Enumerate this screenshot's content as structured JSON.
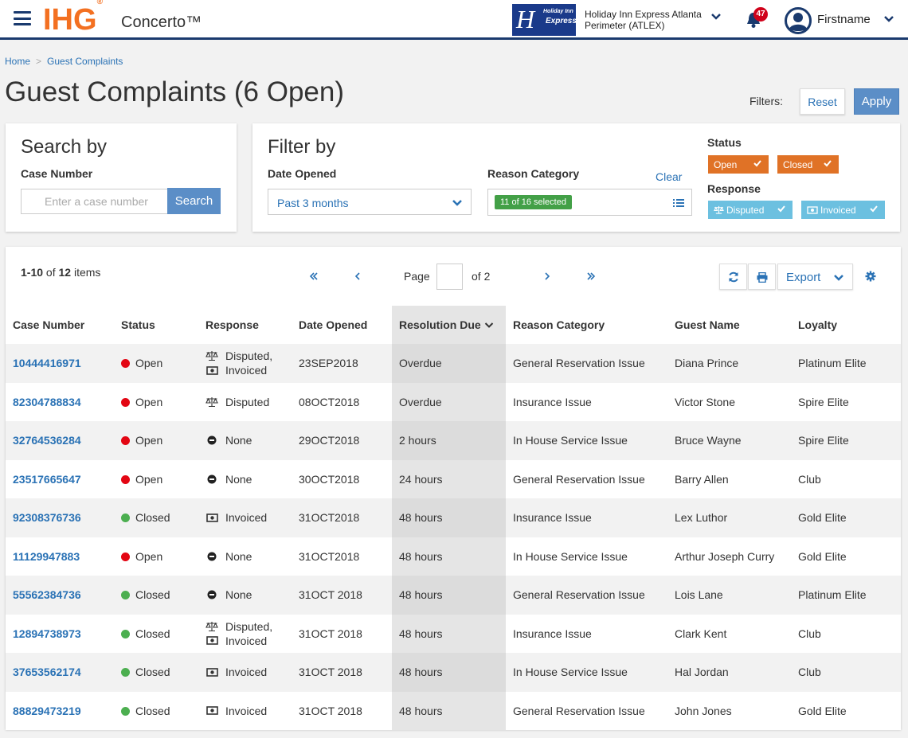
{
  "header": {
    "brand": "IHG",
    "brand_mark": "®",
    "product": "Concerto™",
    "hotel_logo_line1": "Holiday Inn",
    "hotel_logo_line2": "Express",
    "hotel_name": "Holiday Inn Express Atlanta Perimeter (ATLEX)",
    "notifications_count": "47",
    "user_name": "Firstname"
  },
  "breadcrumb": {
    "home": "Home",
    "separator": ">",
    "current": "Guest Complaints"
  },
  "page": {
    "title": "Guest Complaints (6 Open)"
  },
  "filters_bar": {
    "label": "Filters:",
    "reset": "Reset",
    "apply": "Apply"
  },
  "search": {
    "title": "Search by",
    "case_label": "Case Number",
    "placeholder": "Enter a case number",
    "button": "Search"
  },
  "filter": {
    "title": "Filter by",
    "date_label": "Date Opened",
    "date_value": "Past 3 months",
    "reason_label": "Reason Category",
    "reason_selected": "11 of 16 selected",
    "clear": "Clear",
    "status_label": "Status",
    "status_tags": [
      "Open",
      "Closed"
    ],
    "response_label": "Response",
    "response_tags": [
      "Disputed",
      "Invoiced"
    ]
  },
  "table": {
    "range": "1-10",
    "of": "of",
    "total": "12",
    "items": "items",
    "page_label": "Page",
    "page_of": "of 2",
    "export": "Export",
    "columns": [
      "Case Number",
      "Status",
      "Response",
      "Date Opened",
      "Resolution Due",
      "Reason Category",
      "Guest Name",
      "Loyalty"
    ],
    "rows": [
      {
        "case": "10444416971",
        "status": "Open",
        "response": [
          "Disputed,",
          "Invoiced"
        ],
        "date": "23SEP2018",
        "due": "Overdue",
        "reason": "General Reservation Issue",
        "guest": "Diana Prince",
        "loyalty": "Platinum Elite"
      },
      {
        "case": "82304788834",
        "status": "Open",
        "response": [
          "Disputed"
        ],
        "date": "08OCT2018",
        "due": "Overdue",
        "reason": "Insurance Issue",
        "guest": "Victor Stone",
        "loyalty": "Spire Elite"
      },
      {
        "case": "32764536284",
        "status": "Open",
        "response": [
          "None"
        ],
        "date": "29OCT2018",
        "due": "2 hours",
        "reason": "In House Service Issue",
        "guest": "Bruce Wayne",
        "loyalty": "Spire Elite"
      },
      {
        "case": "23517665647",
        "status": "Open",
        "response": [
          "None"
        ],
        "date": "30OCT2018",
        "due": "24 hours",
        "reason": "General Reservation Issue",
        "guest": "Barry Allen",
        "loyalty": "Club"
      },
      {
        "case": "92308376736",
        "status": "Closed",
        "response": [
          "Invoiced"
        ],
        "date": "31OCT2018",
        "due": "48 hours",
        "reason": "Insurance Issue",
        "guest": "Lex Luthor",
        "loyalty": "Gold Elite"
      },
      {
        "case": "11129947883",
        "status": "Open",
        "response": [
          "None"
        ],
        "date": "31OCT2018",
        "due": "48 hours",
        "reason": "In House Service Issue",
        "guest": "Arthur Joseph Curry",
        "loyalty": "Gold Elite"
      },
      {
        "case": "55562384736",
        "status": "Closed",
        "response": [
          "None"
        ],
        "date": "31OCT 2018",
        "due": "48 hours",
        "reason": "General Reservation Issue",
        "guest": "Lois Lane",
        "loyalty": "Platinum Elite"
      },
      {
        "case": "12894738973",
        "status": "Closed",
        "response": [
          "Disputed,",
          "Invoiced"
        ],
        "date": "31OCT 2018",
        "due": "48 hours",
        "reason": "Insurance Issue",
        "guest": "Clark Kent",
        "loyalty": "Club"
      },
      {
        "case": "37653562174",
        "status": "Closed",
        "response": [
          "Invoiced"
        ],
        "date": "31OCT 2018",
        "due": "48 hours",
        "reason": "In House Service Issue",
        "guest": "Hal Jordan",
        "loyalty": "Club"
      },
      {
        "case": "88829473219",
        "status": "Closed",
        "response": [
          "Invoiced"
        ],
        "date": "31OCT 2018",
        "due": "48 hours",
        "reason": "General Reservation Issue",
        "guest": "John Jones",
        "loyalty": "Gold Elite"
      }
    ]
  },
  "colors": {
    "brand_orange": "#f37021",
    "navy": "#1a3a6e",
    "link_blue": "#2a72b5",
    "button_blue": "#5b8ec7",
    "open_red": "#e30613",
    "closed_green": "#4caf50",
    "tag_orange": "#e07226",
    "tag_blue": "#6cc0e0"
  }
}
